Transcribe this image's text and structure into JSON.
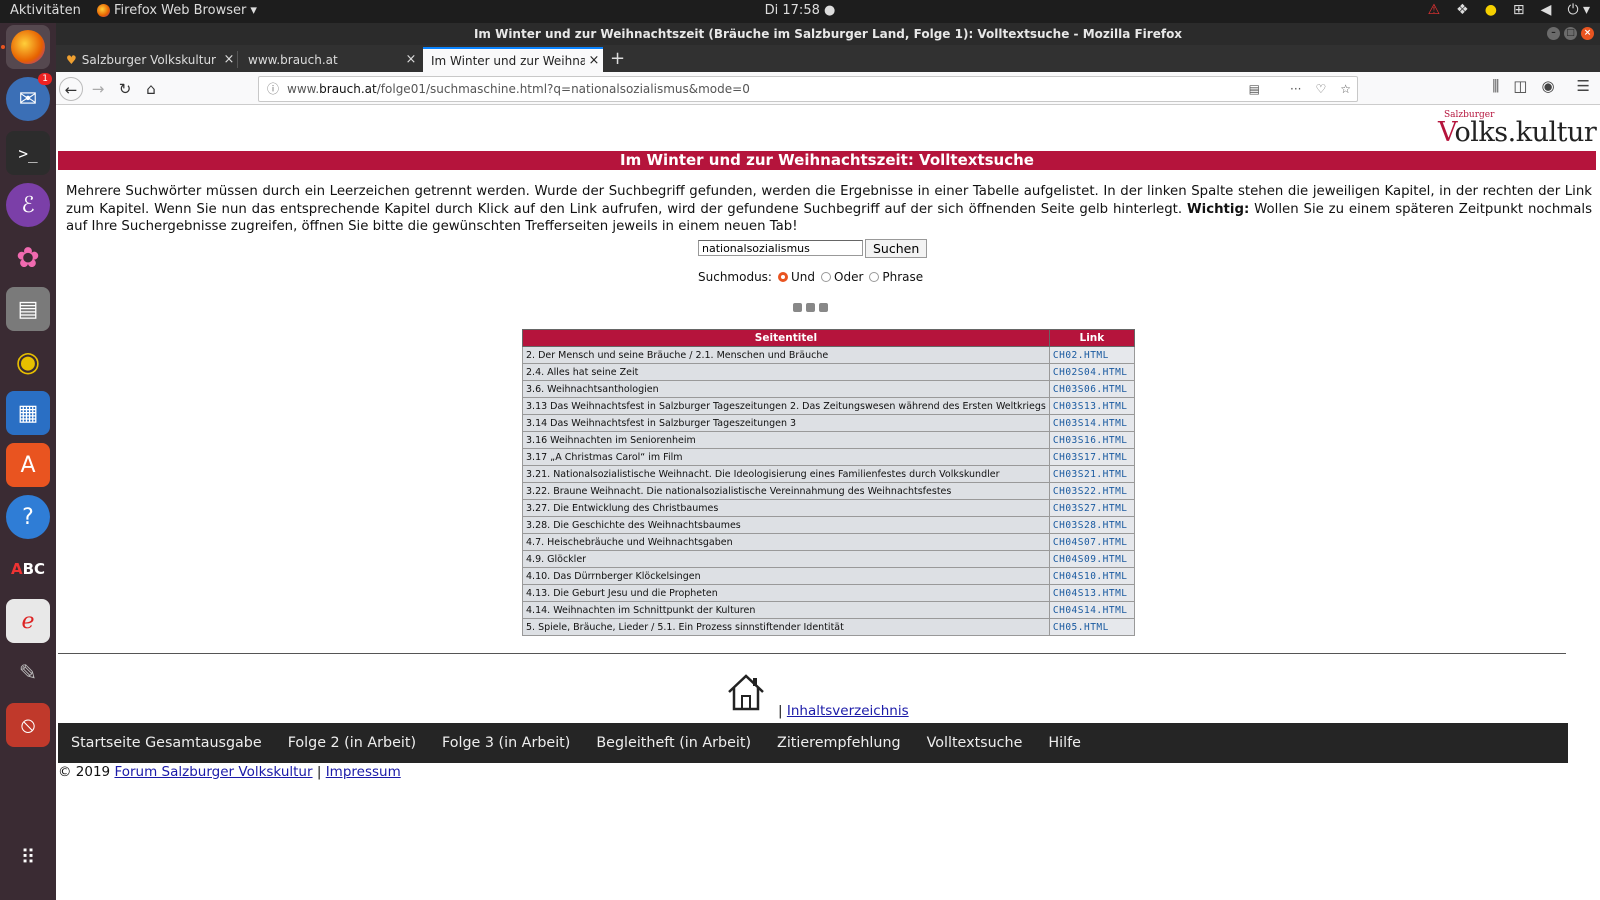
{
  "system": {
    "activities": "Aktivitäten",
    "app_name": "Firefox Web Browser",
    "clock": "Di 17:58 ●"
  },
  "window": {
    "title": "Im Winter und zur Weihnachtszeit (Bräuche im Salzburger Land, Folge 1): Volltextsuche - Mozilla Firefox"
  },
  "tabs": [
    {
      "label": "Salzburger Volkskultur |"
    },
    {
      "label": "www.brauch.at"
    },
    {
      "label": "Im Winter und zur Weihnach"
    }
  ],
  "address": {
    "prefix": "www.",
    "domain": "brauch.at",
    "path": "/folge01/suchmaschine.html?q=nationalsozialismus&mode=0"
  },
  "dock": {
    "mail_badge": "1"
  },
  "logo": {
    "small": "Salzburger",
    "main": "olks.kultur",
    "initial": "V"
  },
  "page": {
    "heading": "Im Winter und zur Weihnachtszeit: Volltextsuche",
    "intro_1": "Mehrere Suchwörter müssen durch ein Leerzeichen getrennt werden. Wurde der Suchbegriff gefunden, werden die Ergebnisse in einer Tabelle aufgelistet. In der linken Spalte stehen die jeweiligen Kapitel, in der rechten der Link zum Kapitel. Wenn Sie nun das entsprechende Kapitel durch Klick auf den Link aufrufen, wird der gefundene Suchbegriff auf der sich öffnenden Seite gelb hinterlegt.",
    "intro_bold": "Wichtig:",
    "intro_2": "Wollen Sie zu einem späteren Zeitpunkt nochmals auf Ihre Suchergebnisse zugreifen, öffnen Sie bitte die gewünschten Trefferseiten jeweils in einem neuen Tab!",
    "search_value": "nationalsozialismus",
    "search_button": "Suchen",
    "mode_label": "Suchmodus:",
    "modes": [
      "Und",
      "Oder",
      "Phrase"
    ],
    "mode_selected": "Und"
  },
  "results": {
    "headers": [
      "Seitentitel",
      "Link"
    ],
    "rows": [
      {
        "title": "2. Der Mensch und seine Bräuche / 2.1. Menschen und Bräuche",
        "link": "CH02.HTML"
      },
      {
        "title": "2.4. Alles hat seine Zeit",
        "link": "CH02S04.HTML"
      },
      {
        "title": "3.6. Weihnachtsanthologien",
        "link": "CH03S06.HTML"
      },
      {
        "title": "3.13 Das Weihnachtsfest in Salzburger Tageszeitungen 2. Das Zeitungswesen während des Ersten Weltkriegs",
        "link": "CH03S13.HTML"
      },
      {
        "title": "3.14 Das Weihnachtsfest in Salzburger Tageszeitungen 3",
        "link": "CH03S14.HTML"
      },
      {
        "title": "3.16 Weihnachten im Seniorenheim",
        "link": "CH03S16.HTML"
      },
      {
        "title": "3.17 „A Christmas Carol“ im Film",
        "link": "CH03S17.HTML"
      },
      {
        "title": "3.21. Nationalsozialistische Weihnacht. Die Ideologisierung eines Familienfestes durch Volkskundler",
        "link": "CH03S21.HTML"
      },
      {
        "title": "3.22. Braune Weihnacht. Die nationalsozialistische Vereinnahmung des Weihnachtsfestes",
        "link": "CH03S22.HTML"
      },
      {
        "title": "3.27. Die Entwicklung des Christbaumes",
        "link": "CH03S27.HTML"
      },
      {
        "title": "3.28. Die Geschichte des Weihnachtsbaumes",
        "link": "CH03S28.HTML"
      },
      {
        "title": "4.7. Heischebräuche und Weihnachtsgaben",
        "link": "CH04S07.HTML"
      },
      {
        "title": "4.9. Glöckler",
        "link": "CH04S09.HTML"
      },
      {
        "title": "4.10. Das Dürrnberger Klöckelsingen",
        "link": "CH04S10.HTML"
      },
      {
        "title": "4.13. Die Geburt Jesu und die Propheten",
        "link": "CH04S13.HTML"
      },
      {
        "title": "4.14. Weihnachten im Schnittpunkt der Kulturen",
        "link": "CH04S14.HTML"
      },
      {
        "title": "5. Spiele, Bräuche, Lieder / 5.1. Ein Prozess sinnstiftender Identität",
        "link": "CH05.HTML"
      }
    ]
  },
  "footer": {
    "sep": "|",
    "toc_link": "Inhaltsverzeichnis",
    "nav": [
      "Startseite Gesamtausgabe",
      "Folge 2 (in Arbeit)",
      "Folge 3 (in Arbeit)",
      "Begleitheft (in Arbeit)",
      "Zitierempfehlung",
      "Volltextsuche",
      "Hilfe"
    ],
    "copyright": "© 2019",
    "forum_link": "Forum Salzburger Volkskultur",
    "imprint_link": "Impressum"
  },
  "colors": {
    "brand_red": "#b5143c",
    "nav_dark": "#252525",
    "ubuntu_orange": "#e95420"
  }
}
